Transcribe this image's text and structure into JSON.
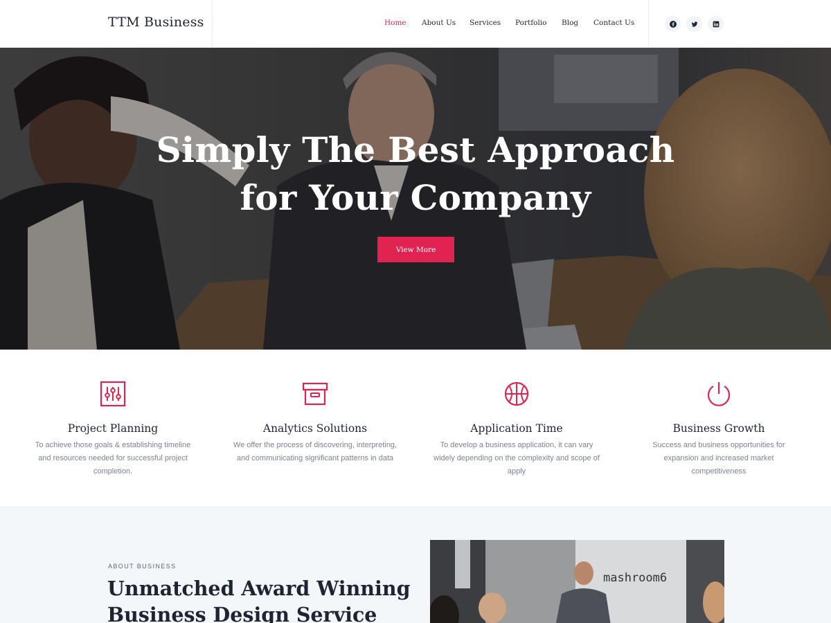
{
  "header": {
    "logo": "TTM Business",
    "nav": [
      {
        "label": "Home",
        "active": true
      },
      {
        "label": "About Us",
        "active": false
      },
      {
        "label": "Services",
        "active": false
      },
      {
        "label": "Portfolio",
        "active": false
      },
      {
        "label": "Blog",
        "active": false
      },
      {
        "label": "Contact Us",
        "active": false
      }
    ],
    "social": [
      "facebook-icon",
      "twitter-icon",
      "linkedin-icon"
    ]
  },
  "hero": {
    "title_line1": "Simply The Best Approach",
    "title_line2": "for Your Company",
    "button_label": "View More"
  },
  "features": [
    {
      "icon": "sliders-icon",
      "title": "Project Planning",
      "desc": "To achieve those goals & establishing timeline and resources needed for successful project completion."
    },
    {
      "icon": "archive-box-icon",
      "title": "Analytics Solutions",
      "desc": "We offer the process of discovering, interpreting, and communicating significant patterns in data"
    },
    {
      "icon": "basketball-icon",
      "title": "Application Time",
      "desc": "To develop a business application, it can vary widely depending on the complexity and scope of apply"
    },
    {
      "icon": "power-icon",
      "title": "Business Growth",
      "desc": "Success and business opportunities for expansion and increased market competitiveness"
    }
  ],
  "about": {
    "kicker": "ABOUT BUSINESS",
    "title_line1": "Unmatched Award Winning",
    "title_line2": "Business Design Service",
    "image_sign": "mashroom6"
  },
  "colors": {
    "accent": "#e02350",
    "text_dark": "#1f2433",
    "text_muted": "#7b8391",
    "about_bg": "#f3f7fa"
  }
}
